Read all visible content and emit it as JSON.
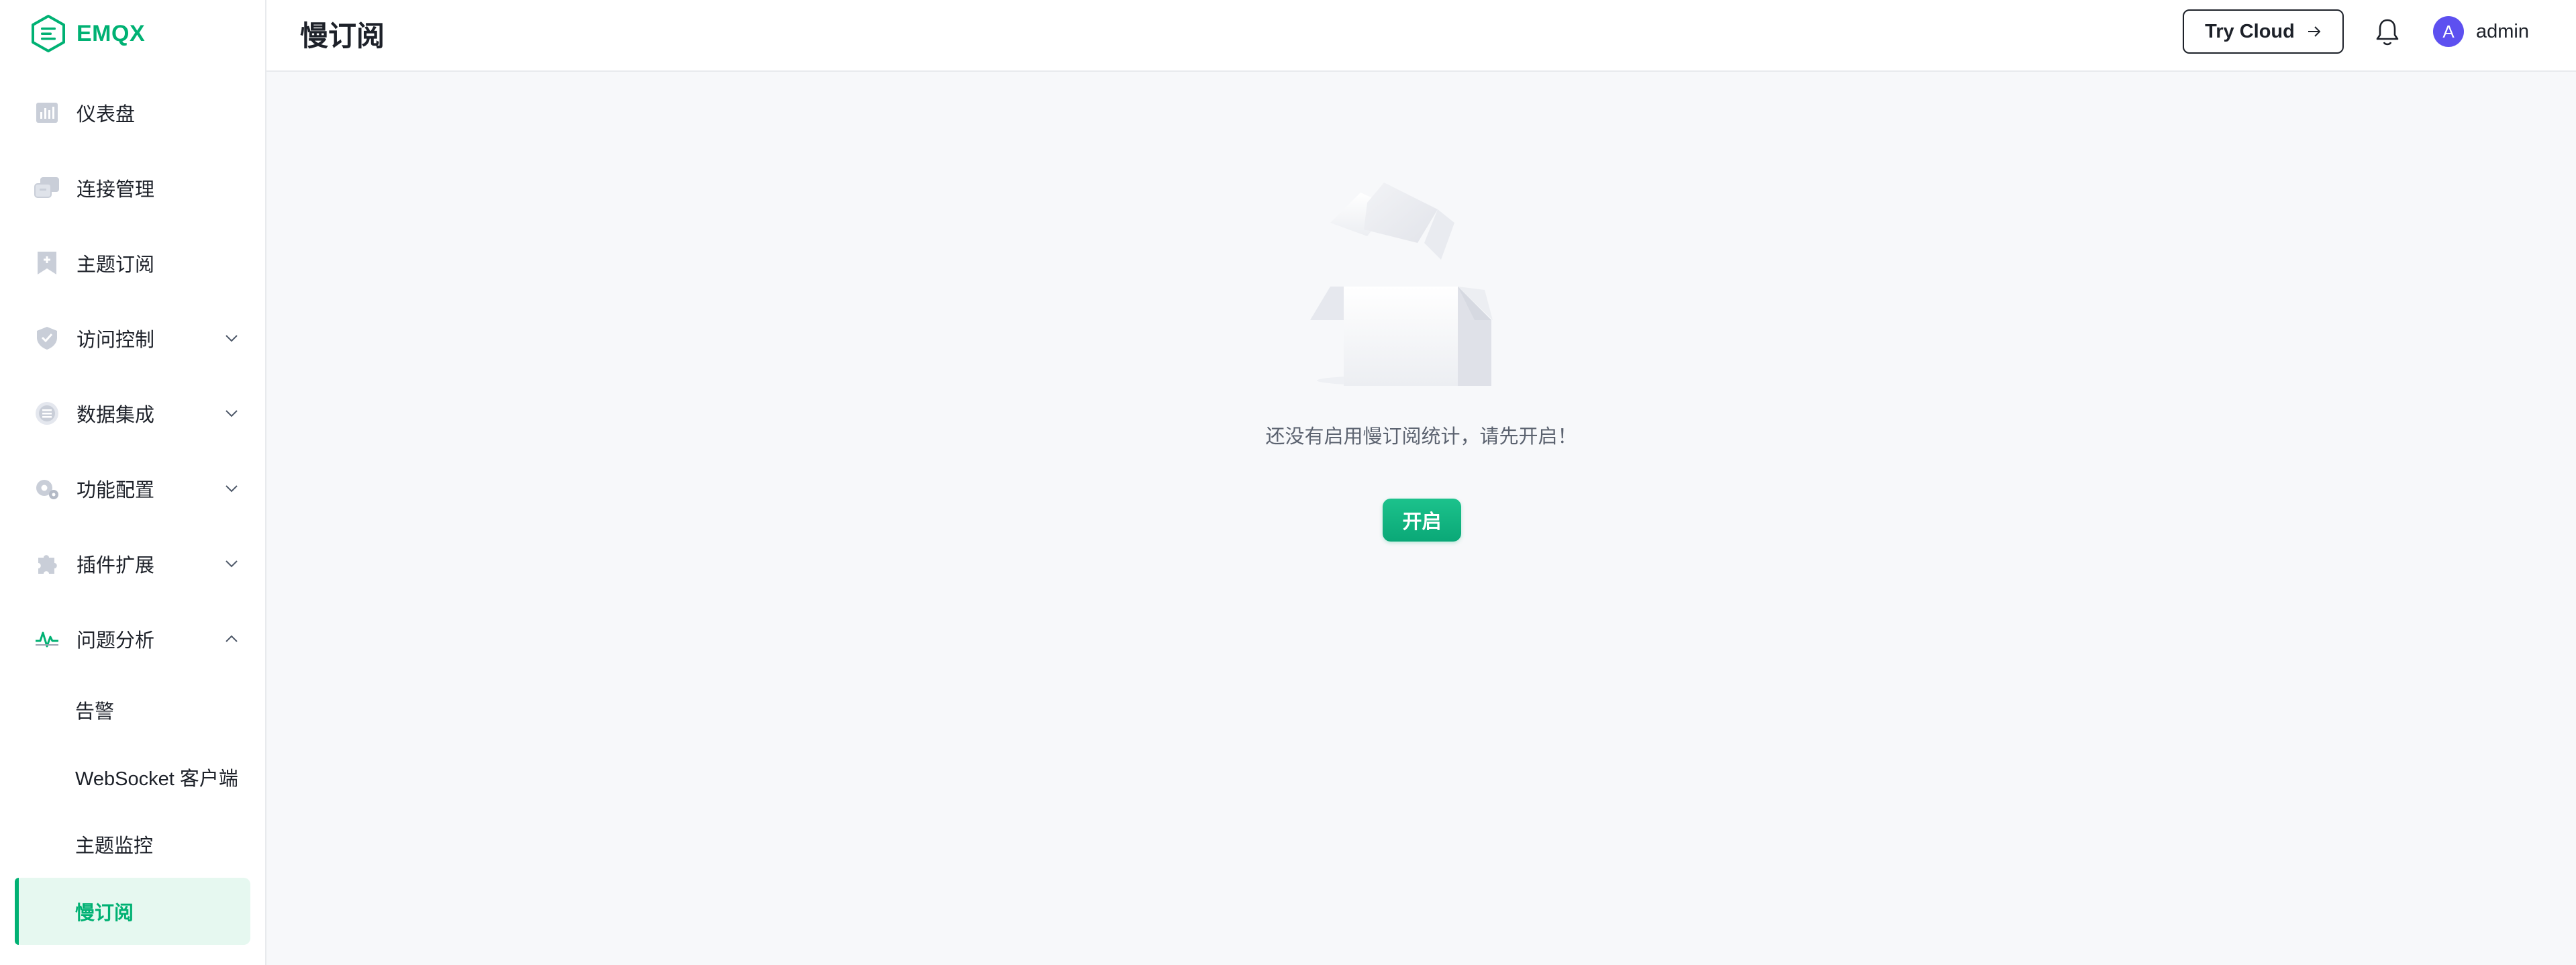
{
  "app": {
    "logo_text": "EMQX",
    "accent_color": "#00b173"
  },
  "header": {
    "title": "慢订阅",
    "try_cloud_label": "Try Cloud",
    "user_initial": "A",
    "username": "admin"
  },
  "sidebar": {
    "items": [
      {
        "label": "仪表盘",
        "icon": "dashboard-icon"
      },
      {
        "label": "连接管理",
        "icon": "connections-icon"
      },
      {
        "label": "主题订阅",
        "icon": "topic-subscription-icon"
      },
      {
        "label": "访问控制",
        "icon": "shield-icon",
        "expandable": true
      },
      {
        "label": "数据集成",
        "icon": "data-integration-icon",
        "expandable": true
      },
      {
        "label": "功能配置",
        "icon": "gear-icon",
        "expandable": true
      },
      {
        "label": "插件扩展",
        "icon": "puzzle-icon",
        "expandable": true
      },
      {
        "label": "问题分析",
        "icon": "pulse-icon",
        "expandable": true,
        "expanded": true
      }
    ],
    "sub_items": [
      {
        "label": "告警"
      },
      {
        "label": "WebSocket 客户端"
      },
      {
        "label": "主题监控"
      },
      {
        "label": "慢订阅",
        "active": true
      }
    ]
  },
  "main": {
    "empty_text": "还没有启用慢订阅统计，请先开启！",
    "enable_button": "开启"
  }
}
